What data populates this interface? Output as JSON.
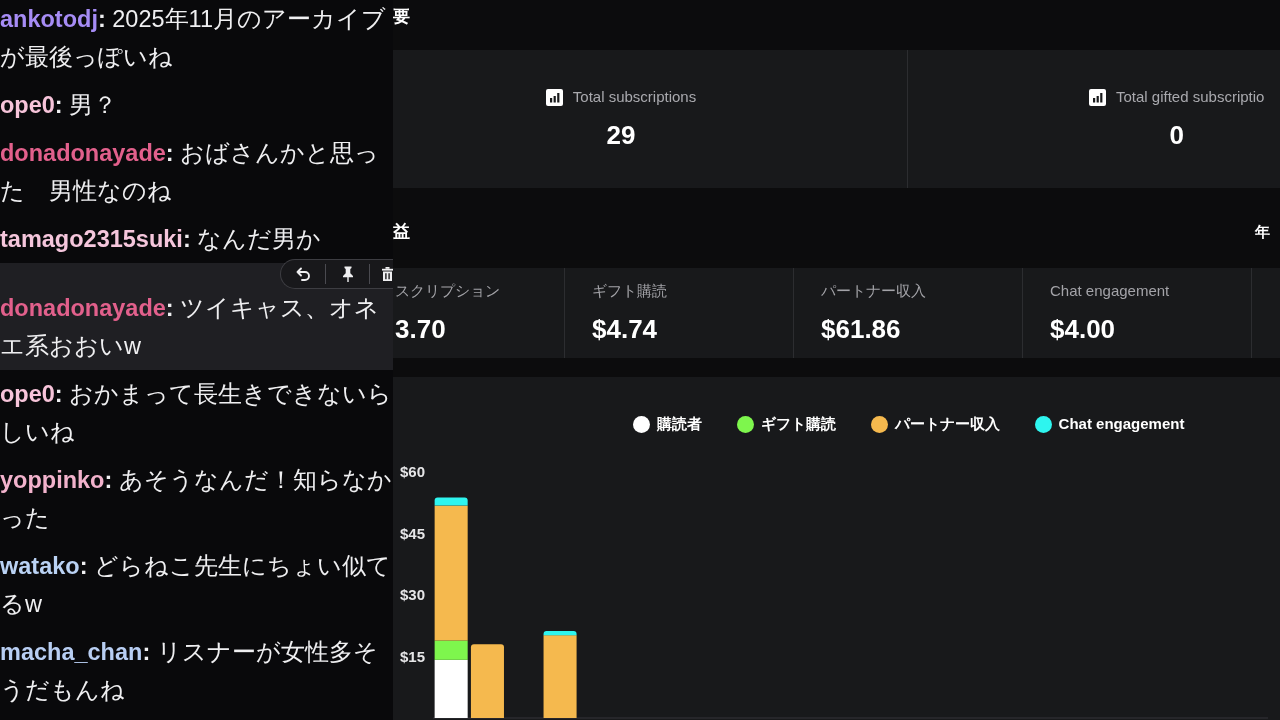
{
  "chat": {
    "messages": [
      {
        "user": "ankotodj",
        "color": "#a68cf5",
        "separator": ":",
        "text": "2025年11月のアーカイブが最後っぽいね",
        "hovered": false
      },
      {
        "user": "ope0",
        "color": "#f7c4da",
        "separator": ":",
        "text": "男？",
        "hovered": false
      },
      {
        "user": "donadonayade",
        "color": "#e2608c",
        "separator": ":",
        "text": "おばさんかと思った　男性なのね",
        "hovered": false
      },
      {
        "user": "tamago2315suki",
        "color": "#f5c6dc",
        "separator": ":",
        "text": "なんだ男か",
        "hovered": false
      },
      {
        "user": "donadonayade",
        "color": "#e2608c",
        "separator": ":",
        "text": "ツイキャス、オネエ系おおいw",
        "hovered": true
      },
      {
        "user": "ope0",
        "color": "#f7c4da",
        "separator": ":",
        "text": "おかまって長生きできないらしいね",
        "hovered": false
      },
      {
        "user": "yoppinko",
        "color": "#f2b2cc",
        "separator": ":",
        "text": "あそうなんだ！知らなかった",
        "hovered": false
      },
      {
        "user": "watako",
        "color": "#bad2f4",
        "separator": ":",
        "text": "どらねこ先生にちょい似てるw",
        "hovered": false
      },
      {
        "user": "macha_chan",
        "color": "#b8cef3",
        "separator": ":",
        "text": "リスナーが女性多そうだもんね",
        "hovered": false
      }
    ]
  },
  "overview": {
    "heading": "要",
    "stats": [
      {
        "label": "Total subscriptions",
        "value": "29"
      },
      {
        "label": "Total gifted subscriptio",
        "value": "0"
      }
    ]
  },
  "revenue": {
    "heading": "益",
    "period": "年",
    "metrics": [
      {
        "label": "スクリプション",
        "value": "3.70"
      },
      {
        "label": "ギフト購読",
        "value": "$4.74"
      },
      {
        "label": "パートナー収入",
        "value": "$61.86"
      },
      {
        "label": "Chat engagement",
        "value": "$4.00"
      }
    ],
    "chart_data": {
      "type": "bar",
      "stacked": true,
      "legend": "top",
      "categories": [
        null,
        null,
        null,
        null,
        null,
        null,
        null,
        null,
        null,
        null,
        null,
        null,
        null,
        null,
        null,
        null,
        null,
        null,
        null,
        null,
        null,
        null,
        null
      ],
      "ylim": [
        0,
        60
      ],
      "yticks": [
        {
          "value": 15,
          "label": "$15"
        },
        {
          "value": 30,
          "label": "$30"
        },
        {
          "value": 45,
          "label": "$45"
        },
        {
          "value": 60,
          "label": "$60"
        }
      ],
      "tick_labels": "y",
      "series": [
        {
          "name": "購読者",
          "color": "#ffffff",
          "values": [
            14.2,
            0,
            0,
            0,
            0,
            0,
            0,
            0,
            0,
            0,
            0,
            0,
            0,
            0,
            0,
            0,
            0,
            0,
            0,
            0,
            0,
            0,
            0
          ]
        },
        {
          "name": "ギフト購読",
          "color": "#7ef64d",
          "values": [
            4.7,
            0,
            0,
            0,
            0,
            0,
            0,
            0,
            0,
            0,
            0,
            0,
            0,
            0,
            0,
            0,
            0,
            0,
            0,
            0,
            0,
            0,
            0
          ]
        },
        {
          "name": "パートナー収入",
          "color": "#f5b94e",
          "values": [
            32.9,
            18,
            0,
            20.2,
            0,
            0,
            0,
            0,
            0,
            0,
            0,
            0,
            0,
            0,
            0,
            0,
            0,
            0,
            0,
            0,
            0,
            0,
            0
          ]
        },
        {
          "name": "Chat engagement",
          "color": "#2ef5ef",
          "values": [
            2,
            0,
            0,
            1,
            0,
            0,
            0,
            0,
            0,
            0,
            0,
            0,
            0,
            0,
            0,
            0,
            0,
            0,
            0,
            0,
            0,
            0,
            0
          ]
        }
      ]
    }
  }
}
